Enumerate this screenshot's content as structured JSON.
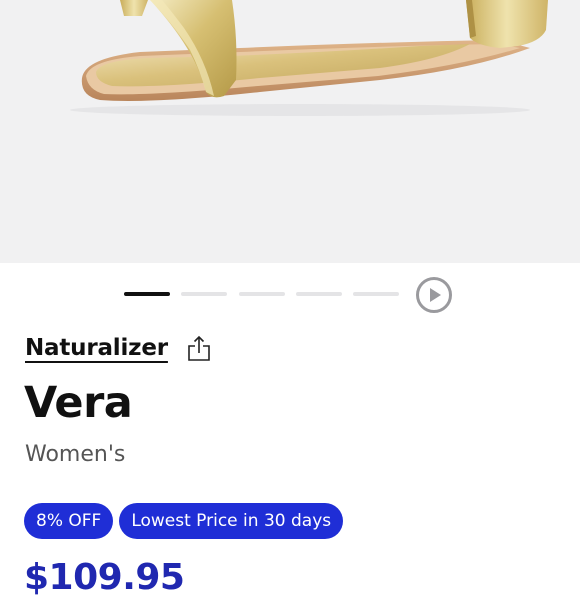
{
  "product": {
    "brand": "Naturalizer",
    "name": "Vera",
    "category": "Women's",
    "price": "$109.95"
  },
  "badges": [
    {
      "label": "8% OFF"
    },
    {
      "label": "Lowest Price in 30 days"
    }
  ],
  "carousel": {
    "slide_count": 5,
    "active_index": 0
  },
  "icons": {
    "share": "share-icon",
    "play": "play-icon"
  },
  "colors": {
    "badge_bg": "#1f2ed6",
    "price": "#2028b0",
    "hero_bg": "#f1f1f2",
    "sandal_gold": "#d8c27a"
  }
}
